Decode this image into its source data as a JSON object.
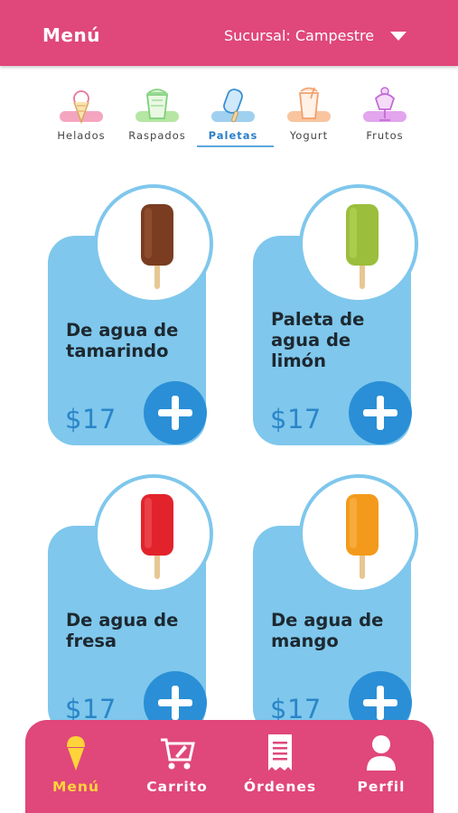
{
  "header": {
    "title": "Menú",
    "branch": "Sucursal: Campestre"
  },
  "tabs": [
    {
      "label": "Helados",
      "icon": "ice-cream-cone-icon",
      "color": "#e8769a"
    },
    {
      "label": "Raspados",
      "icon": "shaved-ice-cup-icon",
      "color": "#7ed07a"
    },
    {
      "label": "Paletas",
      "icon": "popsicle-icon",
      "color": "#5aa7dd",
      "active": true
    },
    {
      "label": "Yogurt",
      "icon": "yogurt-cup-icon",
      "color": "#f2a06a"
    },
    {
      "label": "Frutos",
      "icon": "sundae-glass-icon",
      "color": "#c46ad6"
    }
  ],
  "products": [
    {
      "name": "De agua de tamarindo",
      "price": "$17",
      "color": "#7a3d22"
    },
    {
      "name": "Paleta de agua de limón",
      "price": "$17",
      "color": "#9bbe3c"
    },
    {
      "name": "De agua de fresa",
      "price": "$17",
      "color": "#e2232b"
    },
    {
      "name": "De agua de mango",
      "price": "$17",
      "color": "#f39a1c"
    }
  ],
  "nav": [
    {
      "label": "Menú",
      "icon": "ice-cream-icon",
      "active": true
    },
    {
      "label": "Carrito",
      "icon": "shopping-cart-icon"
    },
    {
      "label": "Órdenes",
      "icon": "receipt-icon"
    },
    {
      "label": "Perfil",
      "icon": "user-icon"
    }
  ],
  "colors": {
    "primary": "#e0477a",
    "card": "#7fc7ec",
    "accent_blue": "#2a8fd6",
    "active_nav": "#ffd43b"
  }
}
